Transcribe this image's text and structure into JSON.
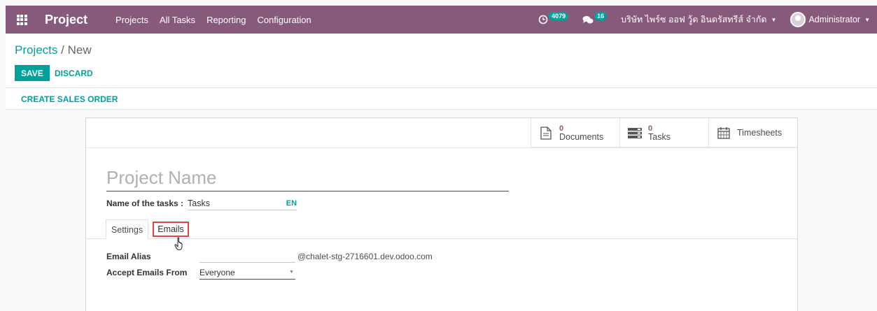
{
  "navbar": {
    "brand": "Project",
    "menu": [
      "Projects",
      "All Tasks",
      "Reporting",
      "Configuration"
    ],
    "activity_count": "4079",
    "message_count": "16",
    "company": "บริษัท ไพร์ซ ออฟ วู้ด อินดรัสทรีส์ จำกัด",
    "user": "Administrator",
    "brand_color": "#875a7b"
  },
  "breadcrumb": {
    "parent": "Projects",
    "separator": " / ",
    "current": "New"
  },
  "actions": {
    "save": "SAVE",
    "discard": "DISCARD"
  },
  "statusbar": {
    "create_sales_order": "CREATE SALES ORDER"
  },
  "smart_buttons": [
    {
      "value": "0",
      "label": "Documents",
      "icon": "document-icon"
    },
    {
      "value": "0",
      "label": "Tasks",
      "icon": "tasks-icon"
    },
    {
      "label": "Timesheets",
      "icon": "calendar-icon"
    }
  ],
  "form": {
    "project_name_placeholder": "Project Name",
    "tasks_label": "Name of the tasks :",
    "tasks_value": "Tasks",
    "lang": "EN"
  },
  "tabs": {
    "settings": "Settings",
    "emails": "Emails",
    "active": "Emails"
  },
  "emails_tab": {
    "alias_label": "Email Alias",
    "alias_domain": "@chalet-stg-2716601.dev.odoo.com",
    "accept_label": "Accept Emails From",
    "accept_value": "Everyone"
  },
  "colors": {
    "accent": "#00a09d",
    "highlight_border": "#e04646"
  }
}
